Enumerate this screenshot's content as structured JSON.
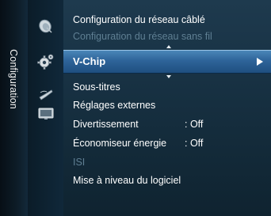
{
  "side_tab": {
    "label": "Configuration"
  },
  "menu": {
    "items_above": [
      {
        "label": "Configuration du réseau câblé"
      },
      {
        "label": "Configuration du réseau sans fil"
      }
    ],
    "selected": {
      "label": "V-Chip"
    },
    "items_below": [
      {
        "label": "Sous-titres",
        "value": ""
      },
      {
        "label": "Réglages externes",
        "value": ""
      },
      {
        "label": "Divertissement",
        "value": ": Off"
      },
      {
        "label": "Économiseur énergie",
        "value": ": Off"
      },
      {
        "label": "ISI",
        "value": ""
      },
      {
        "label": "Mise à niveau du logiciel",
        "value": ""
      }
    ]
  },
  "icons": [
    "satellite-dish-icon",
    "gear-icon",
    "remote-antenna-icon",
    "tv-screen-icon"
  ],
  "colors": {
    "highlight": "#2e6499",
    "disabled_text": "#5f7f93",
    "text": "#ffffff"
  }
}
